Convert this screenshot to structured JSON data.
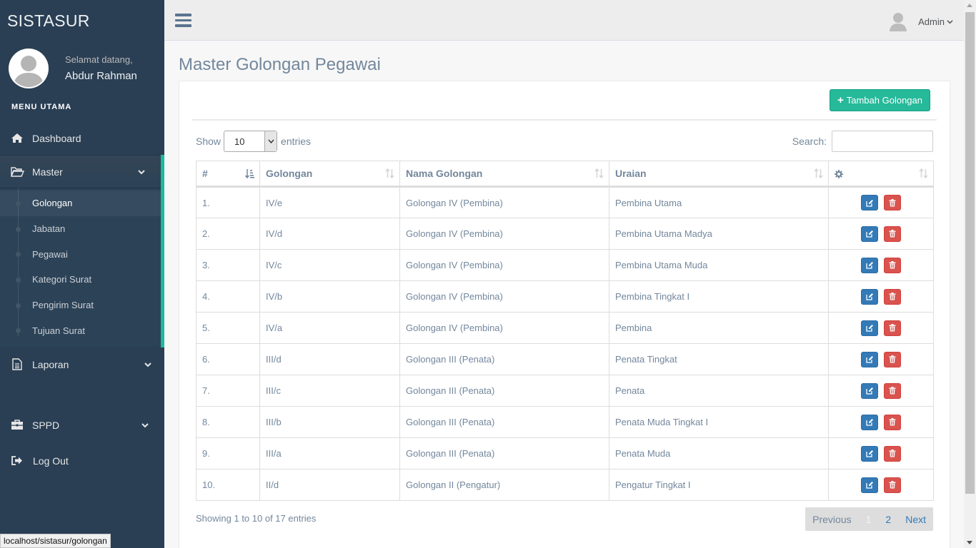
{
  "sidebar": {
    "brand": "SISTASUR",
    "welcome": "Selamat datang,",
    "username": "Abdur Rahman",
    "menu_title": "MENU UTAMA",
    "dashboard": "Dashboard",
    "master": "Master",
    "sub_items": [
      "Golongan",
      "Jabatan",
      "Pegawai",
      "Kategori Surat",
      "Pengirim Surat",
      "Tujuan Surat"
    ],
    "laporan": "Laporan",
    "sppd": "SPPD",
    "logout": "Log Out"
  },
  "status_url": "localhost/sistasur/golongan",
  "topbar": {
    "user": "Admin"
  },
  "page": {
    "title": "Master Golongan Pegawai",
    "add_button": "Tambah Golongan",
    "show_label": "Show",
    "entries_label": "entries",
    "page_length": "10",
    "search_label": "Search:"
  },
  "table": {
    "headers": [
      "#",
      "Golongan",
      "Nama Golongan",
      "Uraian"
    ],
    "rows": [
      [
        "1.",
        "IV/e",
        "Golongan IV (Pembina)",
        "Pembina Utama"
      ],
      [
        "2.",
        "IV/d",
        "Golongan IV (Pembina)",
        "Pembina Utama Madya"
      ],
      [
        "3.",
        "IV/c",
        "Golongan IV (Pembina)",
        "Pembina Utama Muda"
      ],
      [
        "4.",
        "IV/b",
        "Golongan IV (Pembina)",
        "Pembina Tingkat I"
      ],
      [
        "5.",
        "IV/a",
        "Golongan IV (Pembina)",
        "Pembina"
      ],
      [
        "6.",
        "III/d",
        "Golongan III (Penata)",
        "Penata Tingkat"
      ],
      [
        "7.",
        "III/c",
        "Golongan III (Penata)",
        "Penata"
      ],
      [
        "8.",
        "III/b",
        "Golongan III (Penata)",
        "Penata Muda Tingkat I"
      ],
      [
        "9.",
        "III/a",
        "Golongan III (Penata)",
        "Penata Muda"
      ],
      [
        "10.",
        "II/d",
        "Golongan II (Pengatur)",
        "Pengatur Tingkat I"
      ]
    ]
  },
  "footer": {
    "info": "Showing 1 to 10 of 17 entries",
    "previous": "Previous",
    "pages": [
      "1",
      "2"
    ],
    "next": "Next"
  },
  "colors": {
    "sidebar": "#2a3f54",
    "accent": "#26b99a",
    "edit": "#337ab7",
    "delete": "#d9534f"
  },
  "icons": {
    "nav": [
      "home-icon",
      "folder-open-icon",
      "document-icon",
      "briefcase-icon",
      "sign-out-icon"
    ],
    "actions": [
      "edit-icon",
      "trash-icon"
    ],
    "header_action": "gear-icon"
  }
}
